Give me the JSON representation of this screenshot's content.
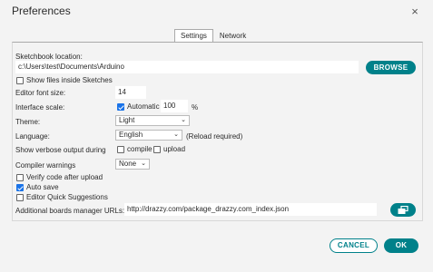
{
  "window": {
    "title": "Preferences",
    "close_icon": "×"
  },
  "tabs": [
    {
      "label": "Settings",
      "active": true
    },
    {
      "label": "Network",
      "active": false
    }
  ],
  "sketchbook": {
    "label": "Sketchbook location:",
    "path": "c:\\Users\\test\\Documents\\Arduino",
    "browse_label": "BROWSE",
    "show_files_label": "Show files inside Sketches",
    "show_files_checked": false
  },
  "editor_font": {
    "label": "Editor font size:",
    "value": "14"
  },
  "interface_scale": {
    "label": "Interface scale:",
    "automatic_label": "Automatic",
    "automatic_checked": true,
    "value": "100",
    "unit": "%"
  },
  "theme": {
    "label": "Theme:",
    "value": "Light"
  },
  "language": {
    "label": "Language:",
    "value": "English",
    "note": "(Reload required)"
  },
  "verbose": {
    "label": "Show verbose output during",
    "compile_label": "compile",
    "compile_checked": false,
    "upload_label": "upload",
    "upload_checked": false
  },
  "compiler_warnings": {
    "label": "Compiler warnings",
    "value": "None"
  },
  "options": [
    {
      "label": "Verify code after upload",
      "checked": false
    },
    {
      "label": "Auto save",
      "checked": true
    },
    {
      "label": "Editor Quick Suggestions",
      "checked": false
    }
  ],
  "boards_manager": {
    "label": "Additional boards manager URLs:",
    "url": "http://drazzy.com/package_drazzy.com_index.json",
    "edit_icon": "window-edit-icon"
  },
  "footer": {
    "cancel_label": "CANCEL",
    "ok_label": "OK"
  },
  "colors": {
    "accent": "#00818a",
    "checkbox": "#1a73e8",
    "background": "#f3f3f3"
  }
}
